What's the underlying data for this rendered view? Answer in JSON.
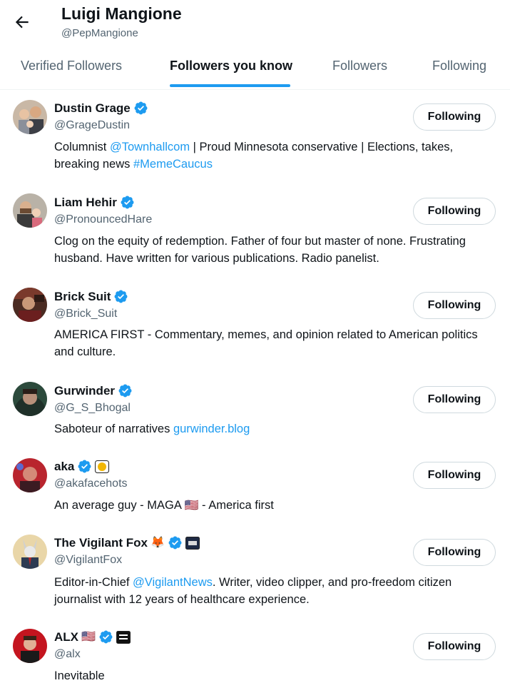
{
  "header": {
    "title": "Luigi Mangione",
    "handle": "@PepMangione",
    "back_icon": "arrow-left-icon"
  },
  "tabs": [
    {
      "label": "Verified Followers",
      "active": false
    },
    {
      "label": "Followers you know",
      "active": true
    },
    {
      "label": "Followers",
      "active": false
    },
    {
      "label": "Following",
      "active": false
    }
  ],
  "accent_color": "#1d9bf0",
  "users": [
    {
      "name": "Dustin Grage",
      "handle": "@GrageDustin",
      "button": "Following",
      "bio_1": "Columnist ",
      "bio_link_1": "@Townhallcom",
      "bio_2": " | Proud Minnesota conservative | Elections, takes, breaking news ",
      "bio_link_2": "#MemeCaucus"
    },
    {
      "name": "Liam Hehir",
      "handle": "@PronouncedHare",
      "button": "Following",
      "bio": "Clog on the equity of redemption. Father of four but master of none. Frustrating husband. Have written for various publications. Radio panelist."
    },
    {
      "name": "Brick Suit",
      "handle": "@Brick_Suit",
      "button": "Following",
      "bio": "AMERICA FIRST - Commentary, memes, and opinion related to American politics and culture."
    },
    {
      "name": "Gurwinder",
      "handle": "@G_S_Bhogal",
      "button": "Following",
      "bio_1": "Saboteur of narratives ",
      "bio_link_1": "gurwinder.blog"
    },
    {
      "name": "aka",
      "handle": "@akafacehots",
      "button": "Following",
      "bio_1": "An average guy - MAGA ",
      "bio_flag": "🇺🇸",
      "bio_2": " - America first"
    },
    {
      "name": "The Vigilant Fox",
      "name_emoji": "🦊",
      "handle": "@VigilantFox",
      "button": "Following",
      "bio_1": "Editor-in-Chief ",
      "bio_link_1": "@VigilantNews",
      "bio_2": ". Writer, video clipper, and pro-freedom citizen journalist with 12 years of healthcare experience."
    },
    {
      "name": "ALX",
      "name_emoji": "🇺🇸",
      "handle": "@alx",
      "button": "Following",
      "bio": "Inevitable"
    }
  ]
}
